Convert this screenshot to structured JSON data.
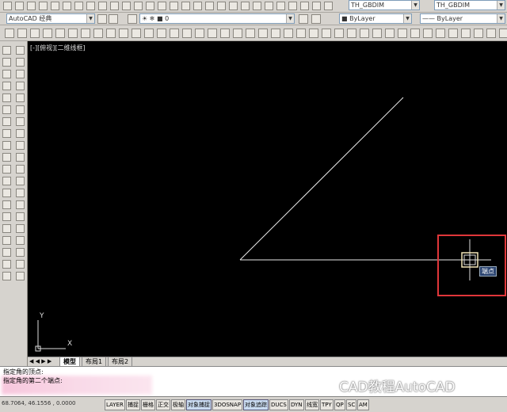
{
  "toolbar": {
    "workspace_combo": "AutoCAD 经典",
    "layer_combo": "0",
    "dimstyle_combo_1": "TH_GBDIM",
    "dimstyle_combo_2": "TH_GBDIM",
    "linetype_combo": "ByLayer",
    "lineweight_combo": "ByLayer"
  },
  "viewport": {
    "label": "[-][俯视][二维线框]",
    "snap_tooltip": "端点",
    "ucs_y": "Y",
    "ucs_x": "X"
  },
  "tabs": [
    {
      "label": "模型",
      "active": true
    },
    {
      "label": "布局1",
      "active": false
    },
    {
      "label": "布局2",
      "active": false
    }
  ],
  "command": {
    "line1": "指定角的顶点:",
    "line2": "指定角的第二个端点:"
  },
  "status": {
    "coords": "68.7064,  46.1556 , 0.0000",
    "buttons": [
      {
        "label": "LAYER",
        "on": false
      },
      {
        "label": "捕捉",
        "on": false
      },
      {
        "label": "栅格",
        "on": false
      },
      {
        "label": "正交",
        "on": false
      },
      {
        "label": "极轴",
        "on": false
      },
      {
        "label": "对象捕捉",
        "on": true
      },
      {
        "label": "3DOSNAP",
        "on": false
      },
      {
        "label": "对象追踪",
        "on": true
      },
      {
        "label": "DUCS",
        "on": false
      },
      {
        "label": "DYN",
        "on": false
      },
      {
        "label": "线宽",
        "on": false
      },
      {
        "label": "TPY",
        "on": false
      },
      {
        "label": "QP",
        "on": false
      },
      {
        "label": "SC",
        "on": false
      },
      {
        "label": "AM",
        "on": false
      }
    ]
  },
  "watermark": "CAD教程AutoCAD",
  "colors": {
    "canvas": "#000000",
    "line": "#e8e8e8",
    "highlight_box": "#e0363a",
    "marker": "#f2e6b8"
  }
}
